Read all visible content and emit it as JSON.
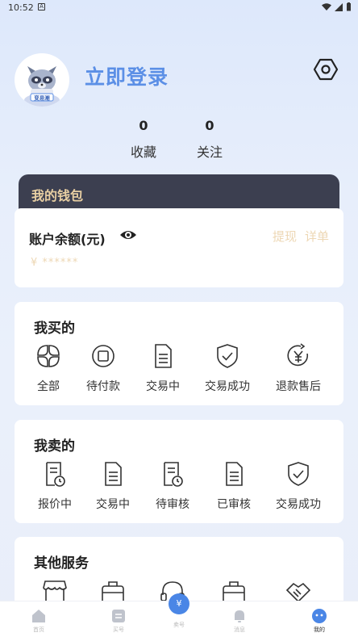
{
  "status": {
    "time": "10:52",
    "app_badge": "A"
  },
  "profile": {
    "login_label": "立即登录",
    "avatar_text": "变易潮"
  },
  "stats": [
    {
      "value": "0",
      "label": "收藏"
    },
    {
      "value": "0",
      "label": "关注"
    }
  ],
  "wallet": {
    "title": "我的钱包",
    "balance_label": "账户余额(元)",
    "withdraw_label": "提现",
    "detail_label": "详单",
    "masked_balance": "¥ ******"
  },
  "buy": {
    "title": "我买的",
    "items": [
      "全部",
      "待付款",
      "交易中",
      "交易成功",
      "退款售后"
    ]
  },
  "sell": {
    "title": "我卖的",
    "items": [
      "报价中",
      "交易中",
      "待审核",
      "已审核",
      "交易成功"
    ]
  },
  "services": {
    "title": "其他服务"
  },
  "nav": {
    "home": "首页",
    "buy": "买号",
    "sell": "卖号",
    "sell_icon": "¥",
    "messages": "消息",
    "mine": "我的"
  },
  "colors": {
    "accent": "#5b8fe6",
    "wallet_bg": "#3c3f50",
    "gold": "#e8cfa3"
  }
}
